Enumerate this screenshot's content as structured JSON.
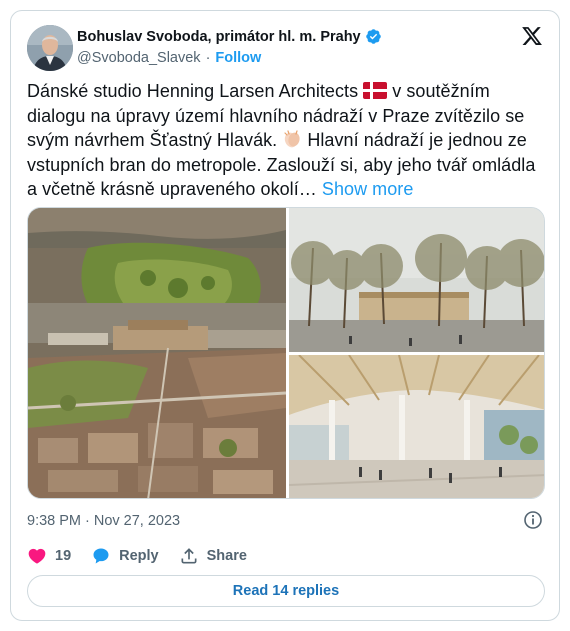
{
  "author": {
    "name": "Bohuslav Svoboda, primátor hl. m. Prahy",
    "handle": "@Svoboda_Slavek",
    "separator": "·",
    "follow_label": "Follow"
  },
  "tweet": {
    "text_part1": "Dánské studio Henning Larsen Architects ",
    "text_part2": " v soutěžním dialogu na úpravy území hlavního nádraží v Praze zvítězilo se svým návrhem Šťastný Hlavák. ",
    "text_part3": " Hlavní nádraží je jednou ze vstupních bran do metropole. Zaslouží si, aby jeho tvář omládla a včetně krásně upraveného okolí…",
    "show_more_label": "Show more"
  },
  "meta": {
    "time": "9:38 PM",
    "separator": "·",
    "date": "Nov 27, 2023"
  },
  "actions": {
    "like_count": "19",
    "reply_label": "Reply",
    "share_label": "Share"
  },
  "read_replies_label": "Read 14 replies",
  "icons": {
    "brand": "x-logo-icon",
    "verified": "verified-badge-icon",
    "flag": "denmark-flag-icon",
    "clap": "clapping-hands-icon",
    "info": "info-icon",
    "like": "heart-icon",
    "reply": "reply-bubble-icon",
    "share": "share-upload-icon"
  },
  "colors": {
    "accent": "#1d9bf0",
    "like": "#f91880",
    "text": "#0f1419",
    "secondary": "#536471",
    "border": "#cfd9de"
  }
}
